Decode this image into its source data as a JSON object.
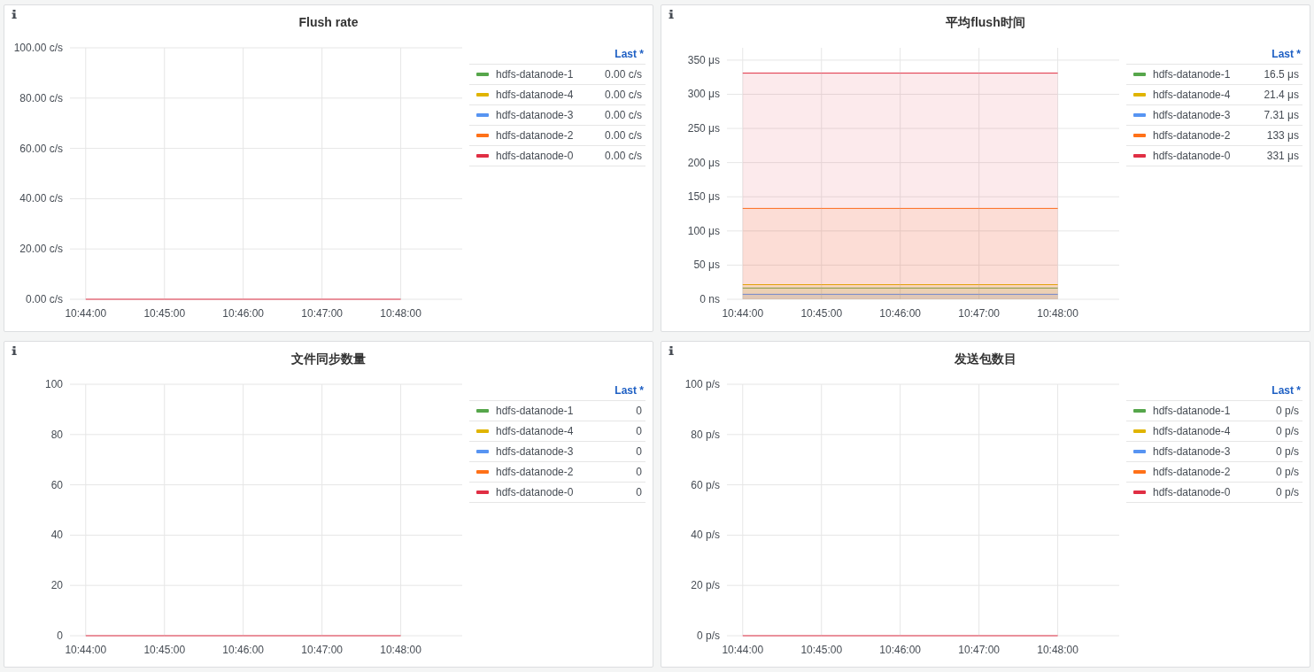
{
  "panels": [
    {
      "title": "Flush rate",
      "legend": {
        "header": "Last *",
        "rows": [
          {
            "value": "0.00 c/s"
          },
          {
            "value": "0.00 c/s"
          },
          {
            "value": "0.00 c/s"
          },
          {
            "value": "0.00 c/s"
          },
          {
            "value": "0.00 c/s"
          }
        ]
      },
      "chart_data": {
        "type": "line",
        "grid": true,
        "categories": [
          "10:44:00",
          "10:45:00",
          "10:46:00",
          "10:47:00",
          "10:48:00"
        ],
        "ylim": [
          0,
          100
        ],
        "yticks": [
          {
            "value": 0,
            "label": "0.00 c/s"
          },
          {
            "value": 20,
            "label": "20.00 c/s"
          },
          {
            "value": 40,
            "label": "40.00 c/s"
          },
          {
            "value": 60,
            "label": "60.00 c/s"
          },
          {
            "value": 80,
            "label": "80.00 c/s"
          },
          {
            "value": 100,
            "label": "100.00 c/s"
          }
        ],
        "series": [
          {
            "name": "hdfs-datanode-1",
            "color": "#56a64b",
            "values": [
              null,
              null,
              null,
              null,
              null
            ]
          },
          {
            "name": "hdfs-datanode-4",
            "color": "#e0b400",
            "values": [
              null,
              null,
              null,
              null,
              null
            ]
          },
          {
            "name": "hdfs-datanode-3",
            "color": "#5794f2",
            "values": [
              null,
              null,
              null,
              null,
              null
            ]
          },
          {
            "name": "hdfs-datanode-2",
            "color": "#ff7118",
            "values": [
              null,
              null,
              null,
              null,
              null
            ]
          },
          {
            "name": "hdfs-datanode-0",
            "color": "#e02f44",
            "values": [
              0,
              0,
              0,
              0,
              0
            ]
          }
        ]
      }
    },
    {
      "title": "平均flush时间",
      "legend": {
        "header": "Last *",
        "rows": [
          {
            "value": "16.5 μs"
          },
          {
            "value": "21.4 μs"
          },
          {
            "value": "7.31 μs"
          },
          {
            "value": "133 μs"
          },
          {
            "value": "331 μs"
          }
        ]
      },
      "chart_data": {
        "type": "area",
        "grid": true,
        "categories": [
          "10:44:00",
          "10:45:00",
          "10:46:00",
          "10:47:00",
          "10:48:00"
        ],
        "ylim": [
          0,
          368
        ],
        "yticks": [
          {
            "value": 0,
            "label": "0 ns"
          },
          {
            "value": 50,
            "label": "50 μs"
          },
          {
            "value": 100,
            "label": "100 μs"
          },
          {
            "value": 150,
            "label": "150 μs"
          },
          {
            "value": 200,
            "label": "200 μs"
          },
          {
            "value": 250,
            "label": "250 μs"
          },
          {
            "value": 300,
            "label": "300 μs"
          },
          {
            "value": 350,
            "label": "350 μs"
          }
        ],
        "series": [
          {
            "name": "hdfs-datanode-1",
            "color": "#56a64b",
            "values": [
              16.5,
              16.5,
              16.5,
              16.5,
              16.5
            ]
          },
          {
            "name": "hdfs-datanode-4",
            "color": "#e0b400",
            "values": [
              21.4,
              21.4,
              21.4,
              21.4,
              21.4
            ]
          },
          {
            "name": "hdfs-datanode-3",
            "color": "#5794f2",
            "values": [
              7.31,
              7.31,
              7.31,
              7.31,
              7.31
            ]
          },
          {
            "name": "hdfs-datanode-2",
            "color": "#ff7118",
            "values": [
              133,
              133,
              133,
              133,
              133
            ]
          },
          {
            "name": "hdfs-datanode-0",
            "color": "#e02f44",
            "values": [
              331,
              331,
              331,
              331,
              331
            ]
          }
        ]
      }
    },
    {
      "title": "文件同步数量",
      "legend": {
        "header": "Last *",
        "rows": [
          {
            "value": "0"
          },
          {
            "value": "0"
          },
          {
            "value": "0"
          },
          {
            "value": "0"
          },
          {
            "value": "0"
          }
        ]
      },
      "chart_data": {
        "type": "line",
        "grid": true,
        "categories": [
          "10:44:00",
          "10:45:00",
          "10:46:00",
          "10:47:00",
          "10:48:00"
        ],
        "ylim": [
          0,
          100
        ],
        "yticks": [
          0,
          20,
          40,
          60,
          80,
          100
        ],
        "series": [
          {
            "name": "hdfs-datanode-1",
            "color": "#56a64b",
            "values": [
              null,
              null,
              null,
              null,
              null
            ]
          },
          {
            "name": "hdfs-datanode-4",
            "color": "#e0b400",
            "values": [
              null,
              null,
              null,
              null,
              null
            ]
          },
          {
            "name": "hdfs-datanode-3",
            "color": "#5794f2",
            "values": [
              null,
              null,
              null,
              null,
              null
            ]
          },
          {
            "name": "hdfs-datanode-2",
            "color": "#ff7118",
            "values": [
              null,
              null,
              null,
              null,
              null
            ]
          },
          {
            "name": "hdfs-datanode-0",
            "color": "#e02f44",
            "values": [
              0,
              0,
              0,
              0,
              0
            ]
          }
        ]
      }
    },
    {
      "title": "发送包数目",
      "legend": {
        "header": "Last *",
        "rows": [
          {
            "value": "0 p/s"
          },
          {
            "value": "0 p/s"
          },
          {
            "value": "0 p/s"
          },
          {
            "value": "0 p/s"
          },
          {
            "value": "0 p/s"
          }
        ]
      },
      "chart_data": {
        "type": "line",
        "grid": true,
        "categories": [
          "10:44:00",
          "10:45:00",
          "10:46:00",
          "10:47:00",
          "10:48:00"
        ],
        "ylim": [
          0,
          100
        ],
        "yticks": [
          {
            "value": 0,
            "label": "0 p/s"
          },
          {
            "value": 20,
            "label": "20 p/s"
          },
          {
            "value": 40,
            "label": "40 p/s"
          },
          {
            "value": 60,
            "label": "60 p/s"
          },
          {
            "value": 80,
            "label": "80 p/s"
          },
          {
            "value": 100,
            "label": "100 p/s"
          }
        ],
        "series": [
          {
            "name": "hdfs-datanode-1",
            "color": "#56a64b",
            "values": [
              null,
              null,
              null,
              null,
              null
            ]
          },
          {
            "name": "hdfs-datanode-4",
            "color": "#e0b400",
            "values": [
              null,
              null,
              null,
              null,
              null
            ]
          },
          {
            "name": "hdfs-datanode-3",
            "color": "#5794f2",
            "values": [
              null,
              null,
              null,
              null,
              null
            ]
          },
          {
            "name": "hdfs-datanode-2",
            "color": "#ff7118",
            "values": [
              null,
              null,
              null,
              null,
              null
            ]
          },
          {
            "name": "hdfs-datanode-0",
            "color": "#e02f44",
            "values": [
              0,
              0,
              0,
              0,
              0
            ]
          }
        ]
      }
    }
  ]
}
